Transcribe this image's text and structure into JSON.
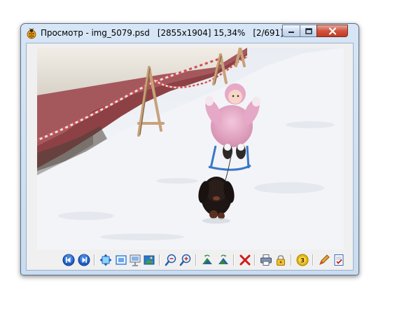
{
  "window": {
    "title": "Просмотр - img_5079.psd   [2855x1904] 15,34%   [2/691]",
    "icon": "ladybug-icon"
  },
  "controls": [
    "minimize-icon",
    "maximize-icon",
    "close-icon"
  ],
  "image": {
    "description_icon": "photo-image"
  },
  "toolbar": {
    "buttons": [
      "previous-image-icon",
      "next-image-icon",
      "fit-window-icon",
      "full-screen-icon",
      "slideshow-icon",
      "wallpaper-icon",
      "zoom-out-icon",
      "zoom-in-icon",
      "rotate-left-icon",
      "rotate-right-icon",
      "delete-icon",
      "print-icon",
      "lock-icon",
      "number-3-icon",
      "edit-icon",
      "properties-icon"
    ]
  },
  "colors": {
    "accent": "#2a6fd6",
    "close": "#c33a22",
    "delete": "#d11b1b"
  }
}
